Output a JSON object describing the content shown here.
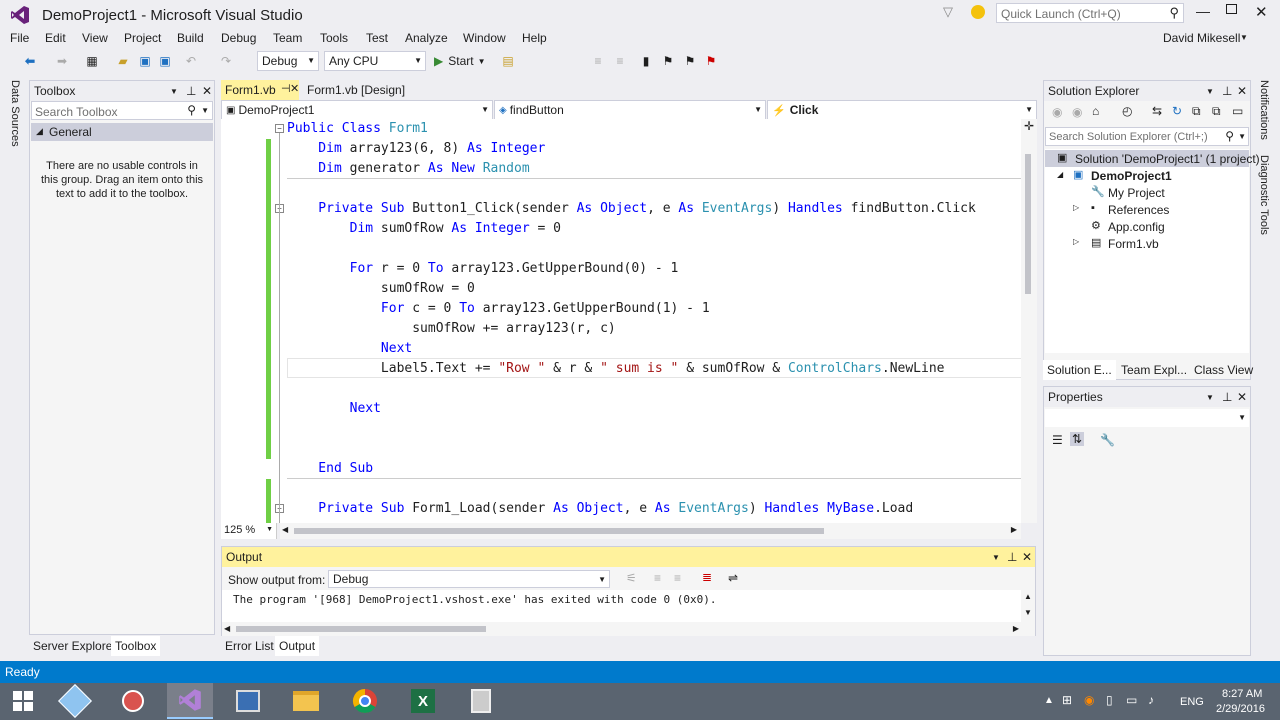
{
  "window": {
    "title": "DemoProject1 - Microsoft Visual Studio",
    "quick_launch_placeholder": "Quick Launch (Ctrl+Q)",
    "user": "David Mikesell"
  },
  "menu": [
    "File",
    "Edit",
    "View",
    "Project",
    "Build",
    "Debug",
    "Team",
    "Tools",
    "Test",
    "Analyze",
    "Window",
    "Help"
  ],
  "toolbar": {
    "config": "Debug",
    "platform": "Any CPU",
    "start_label": "Start"
  },
  "left_vertical_tab": "Data Sources",
  "right_vertical_tabs": [
    "Notifications",
    "Diagnostic Tools"
  ],
  "toolbox": {
    "title": "Toolbox",
    "search_placeholder": "Search Toolbox",
    "group": "General",
    "empty_message": "There are no usable controls in this group. Drag an item onto this text to add it to the toolbox.",
    "bottom_tabs": [
      "Server Explorer",
      "Toolbox"
    ]
  },
  "editor": {
    "tabs": [
      {
        "label": "Form1.vb"
      },
      {
        "label": "Form1.vb [Design]"
      }
    ],
    "nav": {
      "project": "DemoProject1",
      "object": "findButton",
      "event": "Click"
    },
    "zoom": "125 %",
    "lines": [
      [
        {
          "t": "Public Class ",
          "c": "kw"
        },
        {
          "t": "Form1",
          "c": "ty"
        }
      ],
      [
        {
          "t": "    Dim ",
          "c": "kw"
        },
        {
          "t": "array123(6, 8) ",
          "c": ""
        },
        {
          "t": "As Integer",
          "c": "kw"
        }
      ],
      [
        {
          "t": "    Dim ",
          "c": "kw"
        },
        {
          "t": "generator ",
          "c": ""
        },
        {
          "t": "As New ",
          "c": "kw"
        },
        {
          "t": "Random",
          "c": "ty"
        }
      ],
      [
        {
          "t": "",
          "c": ""
        }
      ],
      [
        {
          "t": "    Private Sub ",
          "c": "kw"
        },
        {
          "t": "Button1_Click(sender ",
          "c": ""
        },
        {
          "t": "As Object",
          "c": "kw"
        },
        {
          "t": ", e ",
          "c": ""
        },
        {
          "t": "As ",
          "c": "kw"
        },
        {
          "t": "EventArgs",
          "c": "ty"
        },
        {
          "t": ") ",
          "c": ""
        },
        {
          "t": "Handles ",
          "c": "kw"
        },
        {
          "t": "findButton.Click",
          "c": ""
        }
      ],
      [
        {
          "t": "        Dim ",
          "c": "kw"
        },
        {
          "t": "sumOfRow ",
          "c": ""
        },
        {
          "t": "As Integer",
          "c": "kw"
        },
        {
          "t": " = 0",
          "c": ""
        }
      ],
      [
        {
          "t": "",
          "c": ""
        }
      ],
      [
        {
          "t": "        For ",
          "c": "kw"
        },
        {
          "t": "r = 0 ",
          "c": ""
        },
        {
          "t": "To ",
          "c": "kw"
        },
        {
          "t": "array123.GetUpperBound(0) - 1",
          "c": ""
        }
      ],
      [
        {
          "t": "            sumOfRow = 0",
          "c": ""
        }
      ],
      [
        {
          "t": "            For ",
          "c": "kw"
        },
        {
          "t": "c = 0 ",
          "c": ""
        },
        {
          "t": "To ",
          "c": "kw"
        },
        {
          "t": "array123.GetUpperBound(1) - 1",
          "c": ""
        }
      ],
      [
        {
          "t": "                sumOfRow += array123(r, c)",
          "c": ""
        }
      ],
      [
        {
          "t": "            Next",
          "c": "kw"
        }
      ],
      [
        {
          "t": "            Label5.Text += ",
          "c": ""
        },
        {
          "t": "\"Row \"",
          "c": "str"
        },
        {
          "t": " & r & ",
          "c": ""
        },
        {
          "t": "\" sum is \"",
          "c": "str"
        },
        {
          "t": " & sumOfRow & ",
          "c": ""
        },
        {
          "t": "ControlChars",
          "c": "ty"
        },
        {
          "t": ".NewLine",
          "c": ""
        }
      ],
      [
        {
          "t": "",
          "c": ""
        }
      ],
      [
        {
          "t": "        Next",
          "c": "kw"
        }
      ],
      [
        {
          "t": "",
          "c": ""
        }
      ],
      [
        {
          "t": "",
          "c": ""
        }
      ],
      [
        {
          "t": "    End Sub",
          "c": "kw"
        }
      ],
      [
        {
          "t": "",
          "c": ""
        }
      ],
      [
        {
          "t": "    Private Sub ",
          "c": "kw"
        },
        {
          "t": "Form1_Load(sender ",
          "c": ""
        },
        {
          "t": "As Object",
          "c": "kw"
        },
        {
          "t": ", e ",
          "c": ""
        },
        {
          "t": "As ",
          "c": "kw"
        },
        {
          "t": "EventArgs",
          "c": "ty"
        },
        {
          "t": ") ",
          "c": ""
        },
        {
          "t": "Handles ",
          "c": "kw"
        },
        {
          "t": "MyBase",
          "c": "kw"
        },
        {
          "t": ".Load",
          "c": ""
        }
      ]
    ]
  },
  "output": {
    "title": "Output",
    "show_from_label": "Show output from:",
    "source": "Debug",
    "text": "The program '[968] DemoProject1.vshost.exe' has exited with code 0 (0x0).",
    "bottom_tabs": [
      "Error List",
      "Output"
    ]
  },
  "solution_explorer": {
    "title": "Solution Explorer",
    "search_placeholder": "Search Solution Explorer (Ctrl+;)",
    "items": [
      "Solution 'DemoProject1' (1 project)",
      "DemoProject1",
      "My Project",
      "References",
      "App.config",
      "Form1.vb"
    ],
    "bottom_tabs": [
      "Solution E...",
      "Team Expl...",
      "Class View"
    ]
  },
  "properties": {
    "title": "Properties"
  },
  "status": {
    "text": "Ready"
  },
  "taskbar": {
    "language": "ENG",
    "time": "8:27 AM",
    "date": "2/29/2016"
  },
  "colors": {
    "accent": "#007acc",
    "vs_purple": "#68217a",
    "output_title_bg": "#fff29d"
  }
}
